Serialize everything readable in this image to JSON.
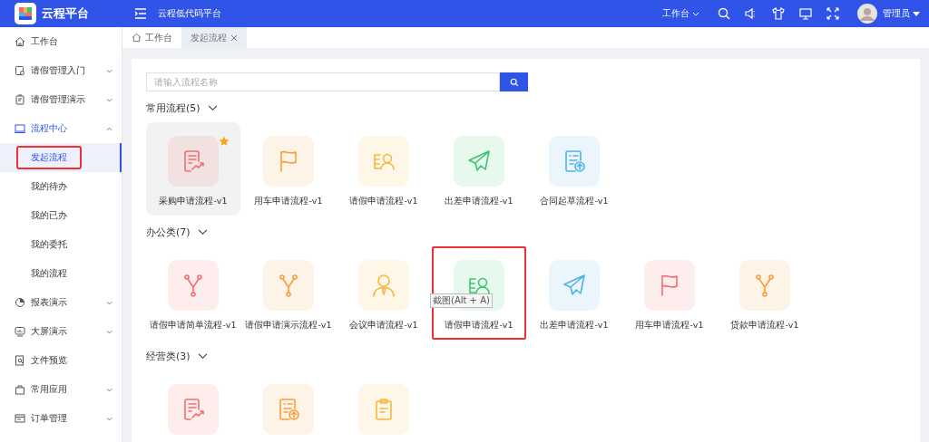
{
  "header": {
    "logo_text": "云程平台",
    "title": "云程低代码平台",
    "workspace": "工作台",
    "user": "管理员"
  },
  "sidebar": {
    "items": [
      {
        "label": "工作台",
        "kind": "home",
        "selected": false
      },
      {
        "label": "请假管理入门",
        "kind": "doc",
        "expanded": false,
        "selected": false
      },
      {
        "label": "请假管理演示",
        "kind": "clipboard",
        "expanded": false,
        "selected": false
      },
      {
        "label": "流程中心",
        "kind": "monitor",
        "expanded": true,
        "selected": true,
        "children": [
          {
            "label": "发起流程",
            "selected": true,
            "highlighted": true
          },
          {
            "label": "我的待办",
            "selected": false,
            "highlighted": false
          },
          {
            "label": "我的已办",
            "selected": false,
            "highlighted": false
          },
          {
            "label": "我的委托",
            "selected": false,
            "highlighted": false
          },
          {
            "label": "我的流程",
            "selected": false,
            "highlighted": false
          }
        ]
      },
      {
        "label": "报表演示",
        "kind": "pie",
        "expanded": false,
        "selected": false
      },
      {
        "label": "大屏演示",
        "kind": "screen",
        "expanded": false,
        "selected": false
      },
      {
        "label": "文件预览",
        "kind": "file",
        "selected": false
      },
      {
        "label": "常用应用",
        "kind": "bag",
        "expanded": false,
        "selected": false
      },
      {
        "label": "订单管理",
        "kind": "card",
        "expanded": false,
        "selected": false
      }
    ]
  },
  "tabs": [
    {
      "label": "工作台",
      "selected": false,
      "closable": false
    },
    {
      "label": "发起流程",
      "selected": true,
      "closable": true
    }
  ],
  "search": {
    "placeholder": "请输入流程名称"
  },
  "sections": [
    {
      "title": "常用流程(5)",
      "expanded": true,
      "items": [
        {
          "label": "采购申请流程-v1",
          "kind": "doc-chart",
          "color": "#f56c6c",
          "starred": true,
          "hovered": true,
          "highlighted": false
        },
        {
          "label": "用车申请流程-v1",
          "kind": "flag",
          "color": "#fa9d3b",
          "starred": false,
          "hovered": false,
          "highlighted": false
        },
        {
          "label": "请假申请流程-v1",
          "kind": "person-card",
          "color": "#f5b83d",
          "starred": false,
          "hovered": false,
          "highlighted": false
        },
        {
          "label": "出差申请流程-v1",
          "kind": "plane",
          "color": "#3cc46e",
          "starred": false,
          "hovered": false,
          "highlighted": false
        },
        {
          "label": "合同起草流程-v1",
          "kind": "doc-upload",
          "color": "#4fb3e8",
          "starred": false,
          "hovered": false,
          "highlighted": false
        }
      ]
    },
    {
      "title": "办公类(7)",
      "expanded": true,
      "items": [
        {
          "label": "请假申请简单流程-v1",
          "kind": "fork",
          "color": "#f56c6c",
          "starred": false,
          "hovered": false,
          "highlighted": false
        },
        {
          "label": "请假申请演示流程-v1",
          "kind": "fork",
          "color": "#fa9d3b",
          "starred": false,
          "hovered": false,
          "highlighted": false
        },
        {
          "label": "会议申请流程-v1",
          "kind": "person",
          "color": "#f5b83d",
          "starred": false,
          "hovered": false,
          "highlighted": false
        },
        {
          "label": "请假申请流程-v1",
          "kind": "person-card",
          "color": "#3cc46e",
          "starred": false,
          "hovered": false,
          "highlighted": true,
          "tooltip": "截图(Alt + A)"
        },
        {
          "label": "出差申请流程-v1",
          "kind": "plane",
          "color": "#4fb3e8",
          "starred": false,
          "hovered": false,
          "highlighted": false
        },
        {
          "label": "用车申请流程-v1",
          "kind": "flag",
          "color": "#f56c6c",
          "starred": false,
          "hovered": false,
          "highlighted": false
        },
        {
          "label": "贷款申请流程-v1",
          "kind": "fork",
          "color": "#fa9d3b",
          "starred": false,
          "hovered": false,
          "highlighted": false
        }
      ]
    },
    {
      "title": "经营类(3)",
      "expanded": true,
      "items": [
        {
          "kind": "doc-chart",
          "color": "#f56c6c",
          "starred": false,
          "hovered": false,
          "highlighted": false
        },
        {
          "kind": "doc-upload",
          "color": "#fa9d3b",
          "starred": false,
          "hovered": false,
          "highlighted": false
        },
        {
          "kind": "clipboard",
          "color": "#f5b83d",
          "starred": false,
          "hovered": false,
          "highlighted": false
        }
      ]
    }
  ]
}
